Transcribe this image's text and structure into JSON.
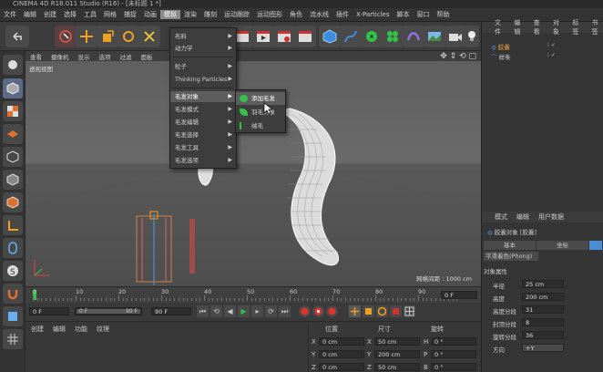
{
  "window": {
    "title": "CINEMA 4D R18.011 Studio (R16) - [未标题 1 *]"
  },
  "menubar": [
    "文件",
    "编辑",
    "创建",
    "选择",
    "工具",
    "网格",
    "捕捉",
    "动画",
    "模拟",
    "渲染",
    "雕刻",
    "运动跟踪",
    "运动图形",
    "角色",
    "流水线",
    "插件",
    "X-Particles",
    "脚本",
    "窗口",
    "帮助"
  ],
  "dropdown": {
    "items": [
      {
        "label": "布料",
        "has_sub": true
      },
      {
        "label": "动力学",
        "has_sub": true
      },
      {
        "label": "粒子",
        "has_sub": true
      },
      {
        "label": "Thinking Particles",
        "has_sub": true
      },
      {
        "label": "毛发对象",
        "has_sub": true,
        "selected": true
      },
      {
        "label": "毛发模式",
        "has_sub": true
      },
      {
        "label": "毛发编辑",
        "has_sub": true
      },
      {
        "label": "毛发选择",
        "has_sub": true
      },
      {
        "label": "毛发工具",
        "has_sub": true
      },
      {
        "label": "毛发选项",
        "has_sub": true
      }
    ]
  },
  "submenu": {
    "items": [
      {
        "label": "添加毛发",
        "selected": true
      },
      {
        "label": "羽毛对象"
      },
      {
        "label": "绒毛"
      }
    ]
  },
  "viewport": {
    "menu": [
      "查看",
      "摄像机",
      "显示",
      "选项",
      "过滤",
      "面板"
    ],
    "label": "透视视图",
    "grid_label": "网格间距 : 1000 cm"
  },
  "timeline": {
    "ticks": [
      "0",
      "10",
      "20",
      "30",
      "40",
      "50",
      "60",
      "70",
      "80",
      "90"
    ],
    "current": "0 F"
  },
  "transport": {
    "start": "0 F",
    "range_start": "0 F",
    "range_end": "90 F",
    "end": "90 F"
  },
  "bottom_menu": [
    "创建",
    "编辑",
    "功能",
    "纹理"
  ],
  "coords": {
    "headers": [
      "位置",
      "尺寸",
      "旋转"
    ],
    "rows": [
      {
        "axis": "X",
        "pos": "0 cm",
        "size": "50 cm",
        "rot_axis": "H",
        "rot": "0 °"
      },
      {
        "axis": "Y",
        "pos": "0 cm",
        "size": "200 cm",
        "rot_axis": "P",
        "rot": "0 °"
      },
      {
        "axis": "Z",
        "pos": "0 cm",
        "size": "50 cm",
        "rot_axis": "B",
        "rot": "0 °"
      }
    ]
  },
  "objects_panel": {
    "menu": [
      "文件",
      "编辑",
      "查看",
      "对象",
      "标签",
      "书签"
    ],
    "items": [
      "胶囊",
      "样条"
    ]
  },
  "attributes_panel": {
    "menu": [
      "模式",
      "编辑",
      "用户数据"
    ],
    "object": "胶囊对象 [胶囊]",
    "tabs": [
      "基本",
      "坐标",
      "对象"
    ],
    "smooth_tag": "平滑着色(Phong)",
    "section": "对象属性",
    "props": [
      {
        "label": "半径",
        "value": "25 cm"
      },
      {
        "label": "高度",
        "value": "200 cm"
      },
      {
        "label": "高度分段",
        "value": "31"
      },
      {
        "label": "封顶分段",
        "value": "8"
      },
      {
        "label": "旋转分段",
        "value": "36"
      },
      {
        "label": "方向",
        "value": "+Y"
      }
    ]
  },
  "colors": {
    "accent": "#4a8fd6",
    "green": "#35c04a"
  }
}
